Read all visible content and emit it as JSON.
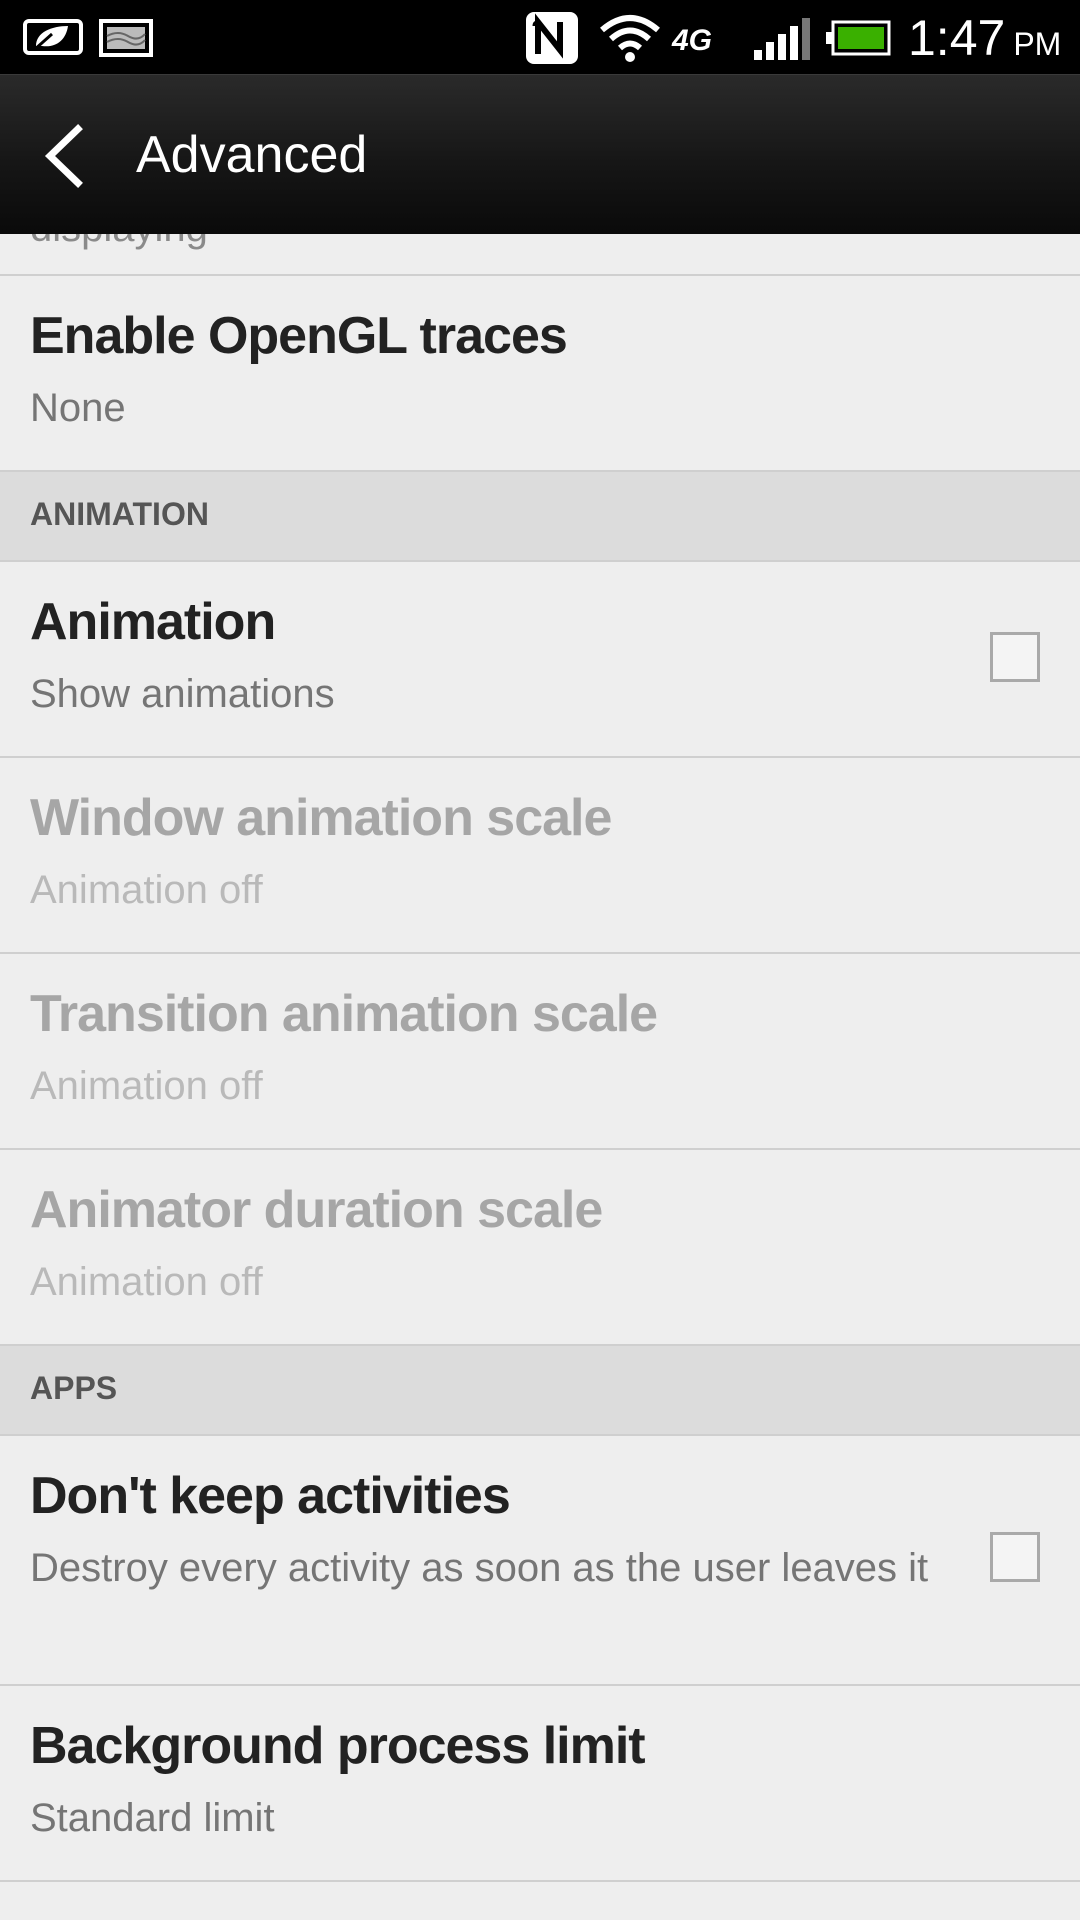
{
  "status_bar": {
    "time": "1:47",
    "ampm": "PM",
    "network_label": "4G",
    "icons": [
      "leaf-notification-icon",
      "image-notification-icon",
      "nfc-icon",
      "wifi-icon",
      "4g-icon",
      "signal-icon",
      "battery-icon"
    ],
    "battery_color": "#3ab000"
  },
  "action_bar": {
    "title": "Advanced"
  },
  "list": {
    "opengl": {
      "title": "Enable OpenGL traces",
      "summary": "None"
    },
    "sections": {
      "animation": "ANIMATION",
      "apps": "APPS"
    },
    "animation": {
      "title": "Animation",
      "summary": "Show animations",
      "checked": false
    },
    "window_scale": {
      "title": "Window animation scale",
      "summary": "Animation off",
      "enabled": false
    },
    "transition_scale": {
      "title": "Transition animation scale",
      "summary": "Animation off",
      "enabled": false
    },
    "animator_scale": {
      "title": "Animator duration scale",
      "summary": "Animation off",
      "enabled": false
    },
    "dont_keep": {
      "title": "Don't keep activities",
      "summary": "Destroy every activity as soon as the user leaves it",
      "checked": false
    },
    "bg_limit": {
      "title": "Background process limit",
      "summary": "Standard limit"
    }
  }
}
